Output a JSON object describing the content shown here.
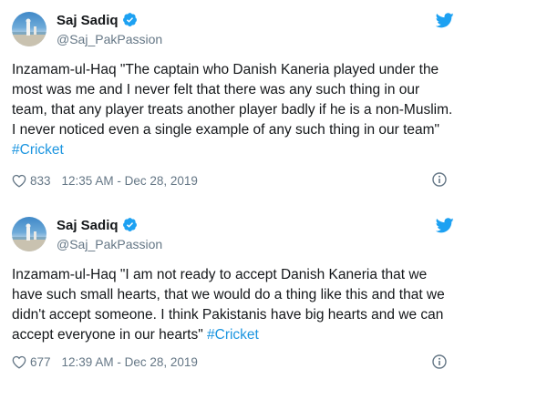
{
  "tweets": [
    {
      "author": {
        "name": "Saj Sadiq",
        "handle": "@Saj_PakPassion",
        "avatar_icon": "avatar-cricket-image",
        "verified_icon": "verified-badge-icon"
      },
      "text": "Inzamam-ul-Haq \"The captain who Danish Kaneria played under the most was me and I never felt that there was any such thing in our team, that any player treats another player badly if he is a non-Muslim. I never noticed even a single example of any such thing in our team\" ",
      "hashtag": "#Cricket",
      "likes": "833",
      "timestamp": "12:35 AM - Dec 28, 2019"
    },
    {
      "author": {
        "name": "Saj Sadiq",
        "handle": "@Saj_PakPassion",
        "avatar_icon": "avatar-cricket-image",
        "verified_icon": "verified-badge-icon"
      },
      "text": "Inzamam-ul-Haq \"I am not ready to accept Danish Kaneria that we have such small hearts, that we would do a thing like this and that we didn't accept someone. I think Pakistanis have big hearts and we can accept everyone in our hearts\" ",
      "hashtag": "#Cricket",
      "likes": "677",
      "timestamp": "12:39 AM - Dec 28, 2019"
    }
  ],
  "colors": {
    "text": "#14171a",
    "secondary": "#657786",
    "link": "#1b95e0",
    "twitter_blue": "#1da1f2"
  }
}
